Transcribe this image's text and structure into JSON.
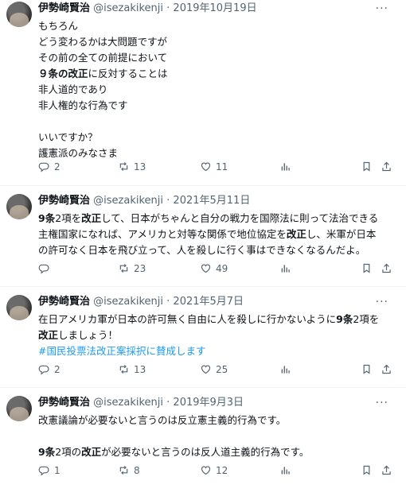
{
  "tweets": [
    {
      "author": "伊勢崎賢治",
      "handle": "@isezakikenji",
      "separator": "·",
      "date": "2019年10月19日",
      "lines": [
        [
          {
            "t": "もちろん"
          }
        ],
        [
          {
            "t": "どう変わるかは大問題ですが"
          }
        ],
        [
          {
            "t": "その前の全ての前提において"
          }
        ],
        [
          {
            "t": "９条の改正",
            "b": true
          },
          {
            "t": "に反対することは"
          }
        ],
        [
          {
            "t": "非人道的であり"
          }
        ],
        [
          {
            "t": "非人権的な行為です"
          }
        ],
        [
          {
            "t": ""
          }
        ],
        [
          {
            "t": "いいですか？"
          }
        ],
        [
          {
            "t": "護憲派のみなさま"
          }
        ]
      ],
      "replies": "2",
      "retweets": "13",
      "likes": "11"
    },
    {
      "author": "伊勢崎賢治",
      "handle": "@isezakikenji",
      "separator": "·",
      "date": "2021年5月11日",
      "lines": [
        [
          {
            "t": "9条",
            "b": true
          },
          {
            "t": "2項を"
          },
          {
            "t": "改正",
            "b": true
          },
          {
            "t": "して、日本がちゃんと自分の戦力を国際法に則って法治できる"
          }
        ],
        [
          {
            "t": "主権国家になれば、アメリカと対等な関係で地位協定を"
          },
          {
            "t": "改正",
            "b": true
          },
          {
            "t": "し、米軍が日本"
          }
        ],
        [
          {
            "t": "の許可なく日本を飛び立って、人を殺しに行く事はできなくなるんだよ。"
          }
        ]
      ],
      "replies": "",
      "retweets": "23",
      "likes": "49"
    },
    {
      "author": "伊勢崎賢治",
      "handle": "@isezakikenji",
      "separator": "·",
      "date": "2021年5月7日",
      "lines": [
        [
          {
            "t": "在日アメリカ軍が日本の許可無く自由に人を殺しに行かないように"
          },
          {
            "t": "9条",
            "b": true
          },
          {
            "t": "2項を"
          }
        ],
        [
          {
            "t": "改正",
            "b": true
          },
          {
            "t": "しましょう！"
          }
        ],
        [
          {
            "t": "#国民投票法改正案採択に賛成します",
            "h": true
          }
        ]
      ],
      "replies": "2",
      "retweets": "13",
      "likes": "25"
    },
    {
      "author": "伊勢崎賢治",
      "handle": "@isezakikenji",
      "separator": "·",
      "date": "2019年9月3日",
      "lines": [
        [
          {
            "t": "改憲議論が必要ないと言うのは反立憲主義的行為です。"
          }
        ],
        [
          {
            "t": ""
          }
        ],
        [
          {
            "t": "9条",
            "b": true
          },
          {
            "t": "2項の"
          },
          {
            "t": "改正",
            "b": true
          },
          {
            "t": "が必要ないと言うのは反人道主義的行為です。"
          }
        ]
      ],
      "replies": "1",
      "retweets": "8",
      "likes": "12"
    }
  ],
  "icons": {
    "more": "more-dots-icon",
    "reply": "reply-icon",
    "retweet": "retweet-icon",
    "like": "heart-icon",
    "views": "views-chart-icon",
    "bookmark": "bookmark-icon",
    "share": "share-icon"
  },
  "more_glyph": "···",
  "colors": {
    "text": "#0f1419",
    "secondary": "#536471",
    "link": "#1d9bf0",
    "divider": "#eff3f4"
  }
}
